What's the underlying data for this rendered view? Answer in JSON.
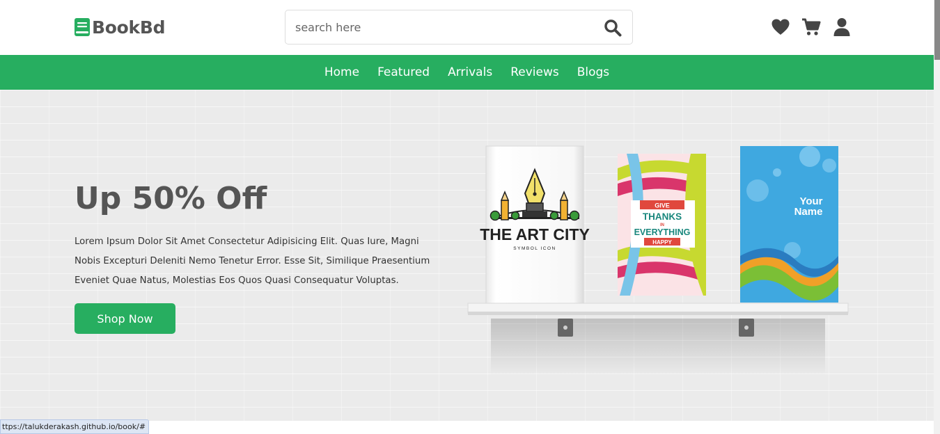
{
  "brand": {
    "name": "BookBd",
    "color": "#27ae60",
    "logo_icon": "book-icon"
  },
  "search": {
    "placeholder": "search here",
    "value": "",
    "icon": "search-icon"
  },
  "header_icons": [
    "heart-icon",
    "cart-icon",
    "user-icon"
  ],
  "nav": {
    "items": [
      {
        "label": "Home"
      },
      {
        "label": "Featured"
      },
      {
        "label": "Arrivals"
      },
      {
        "label": "Reviews"
      },
      {
        "label": "Blogs"
      }
    ]
  },
  "hero": {
    "title": "Up 50% Off",
    "text": "Lorem Ipsum Dolor Sit Amet Consectetur Adipisicing Elit. Quas Iure, Magni Nobis Excepturi Deleniti Nemo Tenetur Error. Esse Sit, Similique Praesentium Eveniet Quae Natus, Molestias Eos Quos Quasi Consequatur Voluptas.",
    "button_label": "Shop Now"
  },
  "books": [
    {
      "title": "THE ART CITY",
      "subtitle": "SYMBOL ICON"
    },
    {
      "line1": "GIVE",
      "line2": "THANKS",
      "line3": "IN",
      "line4": "EVERYTHING",
      "line5": "HAPPY"
    },
    {
      "line1": "Your",
      "line2": "Name"
    }
  ],
  "status_bar": {
    "url": "ttps://talukderakash.github.io/book/#"
  }
}
